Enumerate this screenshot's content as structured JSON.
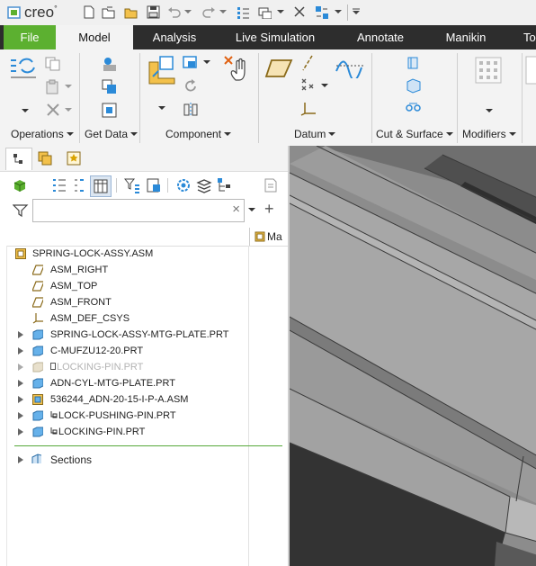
{
  "app": {
    "logo": "creo",
    "logo_mark": "°"
  },
  "tabs": [
    {
      "label": "File"
    },
    {
      "label": "Model"
    },
    {
      "label": "Analysis"
    },
    {
      "label": "Live Simulation"
    },
    {
      "label": "Annotate"
    },
    {
      "label": "Manikin"
    },
    {
      "label": "To"
    }
  ],
  "ribbon": {
    "groups": [
      {
        "label": "Operations"
      },
      {
        "label": "Get Data"
      },
      {
        "label": "Component"
      },
      {
        "label": "Datum"
      },
      {
        "label": "Cut & Surface"
      },
      {
        "label": "Modifiers"
      }
    ]
  },
  "filter": {
    "value": "",
    "clear_symbol": "×",
    "add_symbol": "+"
  },
  "tree": {
    "column_header": "Ma",
    "items": [
      {
        "label": "SPRING-LOCK-ASSY.ASM",
        "icon": "assembly-icon",
        "expandable": false,
        "dim": false
      },
      {
        "label": "ASM_RIGHT",
        "icon": "datum-plane-icon",
        "expandable": false,
        "dim": false
      },
      {
        "label": "ASM_TOP",
        "icon": "datum-plane-icon",
        "expandable": false,
        "dim": false
      },
      {
        "label": "ASM_FRONT",
        "icon": "datum-plane-icon",
        "expandable": false,
        "dim": false
      },
      {
        "label": "ASM_DEF_CSYS",
        "icon": "csys-icon",
        "expandable": false,
        "dim": false
      },
      {
        "label": "SPRING-LOCK-ASSY-MTG-PLATE.PRT",
        "icon": "part-icon",
        "expandable": true,
        "dim": false
      },
      {
        "label": "C-MUFZU12-20.PRT",
        "icon": "part-icon",
        "expandable": true,
        "dim": false
      },
      {
        "label": "LOCKING-PIN.PRT",
        "icon": "part-icon",
        "expandable": true,
        "dim": true
      },
      {
        "label": "ADN-CYL-MTG-PLATE.PRT",
        "icon": "part-icon",
        "expandable": true,
        "dim": false
      },
      {
        "label": "536244_ADN-20-15-I-P-A.ASM",
        "icon": "assembly-icon",
        "expandable": true,
        "dim": false
      },
      {
        "label": "LOCK-PUSHING-PIN.PRT",
        "icon": "part-icon",
        "expandable": true,
        "dim": false
      },
      {
        "label": "LOCKING-PIN.PRT",
        "icon": "part-icon",
        "expandable": true,
        "dim": false
      }
    ],
    "sections_label": "Sections"
  },
  "colors": {
    "file_tab": "#5cb030",
    "tab_bar": "#2d2d2d",
    "ribbon_bg": "#f3f3f3",
    "accent_blue": "#2b8ad8",
    "insert_line": "#57a83a",
    "viewport_bg": "#7a7a7a"
  }
}
